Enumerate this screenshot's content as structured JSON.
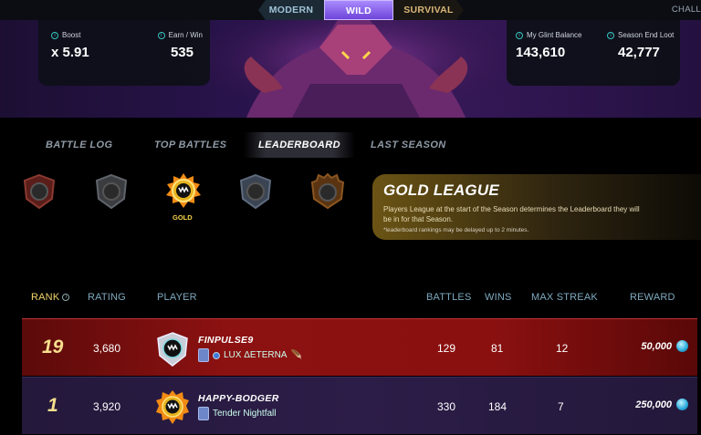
{
  "format_tabs": {
    "modern": "MODERN",
    "wild": "WILD",
    "survival": "SURVIVAL",
    "challenge": "CHALL"
  },
  "stats": {
    "boost_label": "Boost",
    "boost_value": "x 5.91",
    "earn_label": "Earn / Win",
    "earn_value": "535",
    "glint_label": "My Glint Balance",
    "glint_value": "143,610",
    "loot_label": "Season End Loot",
    "loot_value": "42,777"
  },
  "section_tabs": [
    "BATTLE LOG",
    "TOP BATTLES",
    "LEADERBOARD",
    "LAST SEASON"
  ],
  "active_section": "LEADERBOARD",
  "leagues": {
    "selected_label": "GOLD"
  },
  "league_panel": {
    "title": "GOLD LEAGUE",
    "description": "Players League at the start of the Season determines the Leaderboard they will be in for that Season.",
    "note": "*leaderboard rankings may be delayed up to 2 minutes."
  },
  "table": {
    "headers": {
      "rank": "RANK",
      "rating": "RATING",
      "player": "PLAYER",
      "battles": "BATTLES",
      "wins": "WINS",
      "max_streak": "MAX STREAK",
      "reward": "REWARD"
    },
    "rows": [
      {
        "rank": "19",
        "rating": "3,680",
        "player": "FINPULSE9",
        "guild": "LUX ΔETERNA",
        "battles": "129",
        "wins": "81",
        "max_streak": "12",
        "reward": "50,000"
      },
      {
        "rank": "1",
        "rating": "3,920",
        "player": "HAPPY-BODGER",
        "guild": "Tender Nightfall",
        "battles": "330",
        "wins": "184",
        "max_streak": "7",
        "reward": "250,000"
      }
    ]
  },
  "colors": {
    "accent_gold": "#f7df8e",
    "header_blue": "#7ea9bf",
    "highlight_row": "#8c1111",
    "wild_purple": "#6e44d8"
  }
}
